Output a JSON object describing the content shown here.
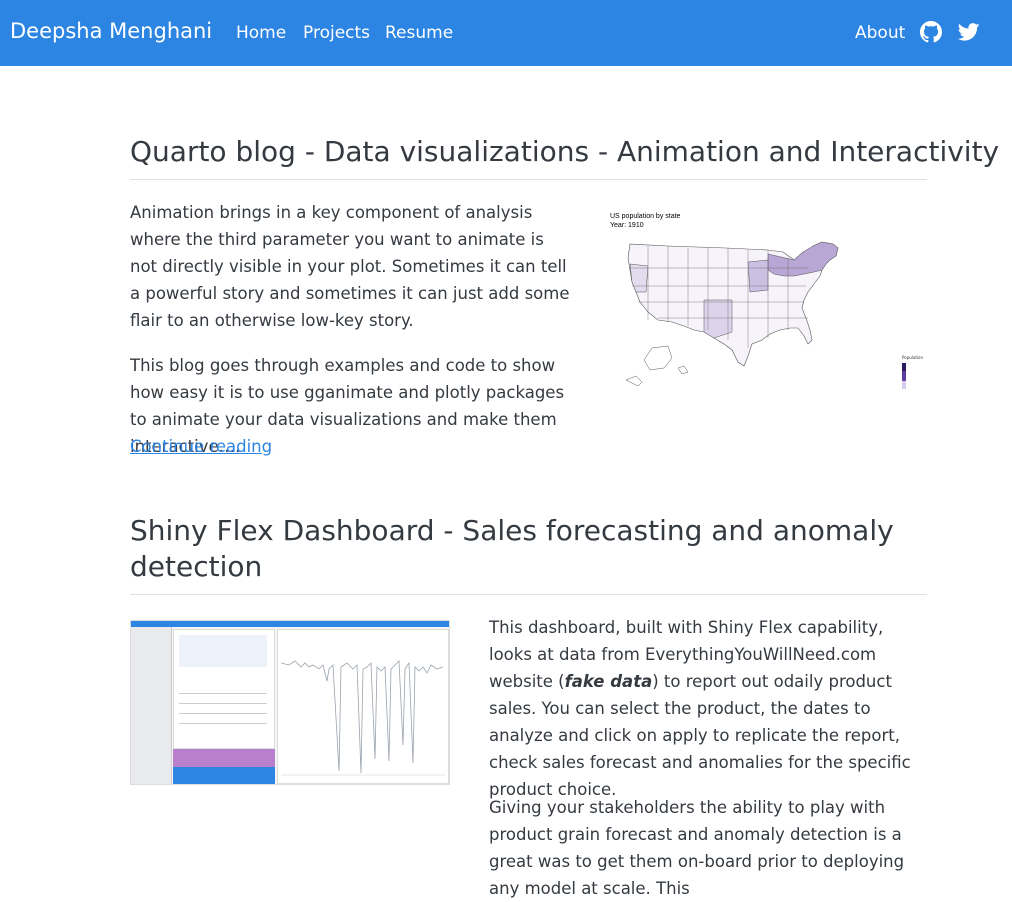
{
  "navbar": {
    "brand": "Deepsha Menghani",
    "links": [
      "Home",
      "Projects",
      "Resume"
    ],
    "about": "About",
    "icons": [
      "github-icon",
      "twitter-icon"
    ],
    "color": "#2c84e3"
  },
  "posts": [
    {
      "title": "Quarto blog - Data visualizations - Animation and Interactivity",
      "paragraphs": [
        "Animation brings in a key component of analysis where the third parameter you want to animate is not directly visible in your plot. Sometimes it can tell a powerful story and sometimes it can just add some flair to an otherwise low-key story.",
        "This blog goes through examples and code to show how easy it is to use gganimate and plotly packages to animate your data visualizations and make them interactive…."
      ],
      "continue_link": "Continue reading",
      "thumbnail": {
        "title_line1": "US population by state",
        "title_line2": "Year: 1910",
        "legend_title": "Population"
      }
    },
    {
      "title_line1": "Shiny Flex Dashboard - Sales forecasting and anomaly",
      "title_line2": "detection",
      "p1_a": "This dashboard, built with Shiny Flex capability, looks at data from EverythingYouWillNeed.com website (",
      "p1_em": "fake data",
      "p1_b": ") to report out odaily product sales. You can select the product, the dates to analyze and click on apply to replicate the report, check sales forecast and anomalies for the specific product choice.",
      "p2": "Giving your stakeholders the ability to play with product grain forecast and anomaly detection is a great was to get them on-board prior to deploying any model at scale. This"
    }
  ]
}
